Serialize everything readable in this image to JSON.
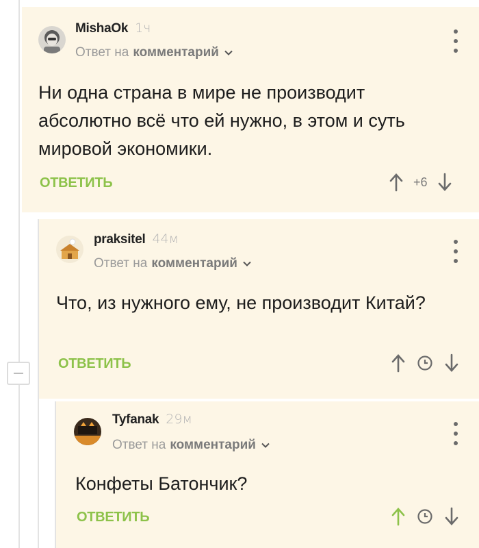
{
  "comments": [
    {
      "author": "MishaOk",
      "time": "1ч",
      "reply_prefix": "Ответ на",
      "reply_target": "комментарий",
      "text": "Ни одна страна в мире не производит абсолютно всё что ей нужно, в этом и суть мировой экономики.",
      "reply_label": "ОТВЕТИТЬ",
      "rating": "+6",
      "upvoted": false
    },
    {
      "author": "praksitel",
      "time": "44м",
      "reply_prefix": "Ответ на",
      "reply_target": "комментарий",
      "text": "Что, из нужного ему, не производит Китай?",
      "reply_label": "ОТВЕТИТЬ",
      "rating_pending": true,
      "upvoted": false
    },
    {
      "author": "Tyfanak",
      "time": "29м",
      "reply_prefix": "Ответ на",
      "reply_target": "комментарий",
      "text": "Конфеты Батончик?",
      "reply_label": "ОТВЕТИТЬ",
      "rating_pending": true,
      "upvoted": true
    }
  ],
  "colors": {
    "comment_bg": "#fdf6e6",
    "reply_green": "#8dc24a",
    "upvote_active": "#8dc24a",
    "text": "#1d1d1d",
    "meta": "#9a9a9a"
  },
  "icons": [
    "more-vertical-icon",
    "chevron-down-icon",
    "arrow-up-icon",
    "arrow-down-icon",
    "clock-icon",
    "collapse-minus-icon"
  ]
}
